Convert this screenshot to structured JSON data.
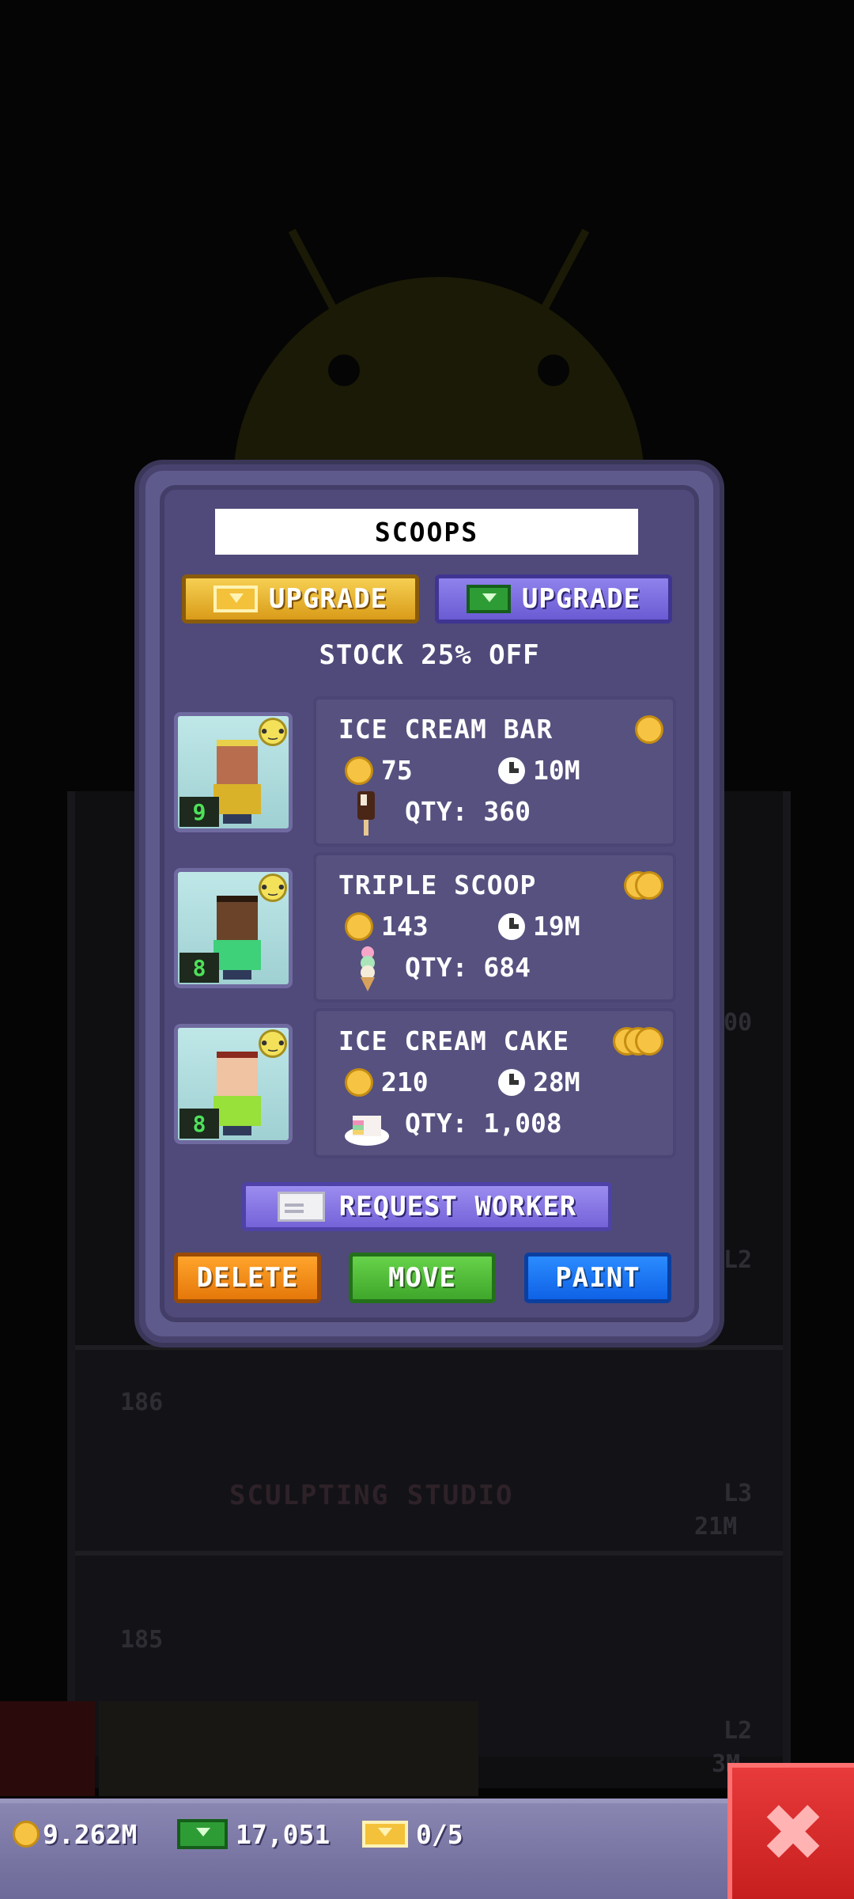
{
  "background": {
    "floor_numbers": [
      "186",
      "185"
    ],
    "floor_label": "SCULPTING STUDIO",
    "level_tags": [
      "L2",
      "L3",
      "L2"
    ],
    "time_tags": [
      "21M",
      "3M"
    ],
    "partial_text": "00"
  },
  "modal": {
    "title": "SCOOPS",
    "upgrade_gold_label": "UPGRADE",
    "upgrade_cash_label": "UPGRADE",
    "promo": "STOCK 25% OFF",
    "products": [
      {
        "name": "ICE CREAM BAR",
        "coin_tier": 1,
        "cost": "75",
        "time": "10M",
        "qty": "QTY: 360",
        "worker_level": "9",
        "icon": "ice-cream-bar-icon"
      },
      {
        "name": "TRIPLE SCOOP",
        "coin_tier": 2,
        "cost": "143",
        "time": "19M",
        "qty": "QTY: 684",
        "worker_level": "8",
        "icon": "triple-scoop-icon"
      },
      {
        "name": "ICE CREAM CAKE",
        "coin_tier": 3,
        "cost": "210",
        "time": "28M",
        "qty": "QTY: 1,008",
        "worker_level": "8",
        "icon": "ice-cream-cake-icon"
      }
    ],
    "request_worker_label": "REQUEST WORKER",
    "actions": {
      "delete": "DELETE",
      "move": "MOVE",
      "paint": "PAINT"
    }
  },
  "status_bar": {
    "coins": "9.262M",
    "bux": "17,051",
    "tickets": "0/5"
  },
  "colors": {
    "modal_bg": "#4f4a7a",
    "gold": "#f6c343",
    "delete": "#ffa42b",
    "move": "#67d24a",
    "paint": "#2b8cff",
    "close": "#e83a3a"
  }
}
